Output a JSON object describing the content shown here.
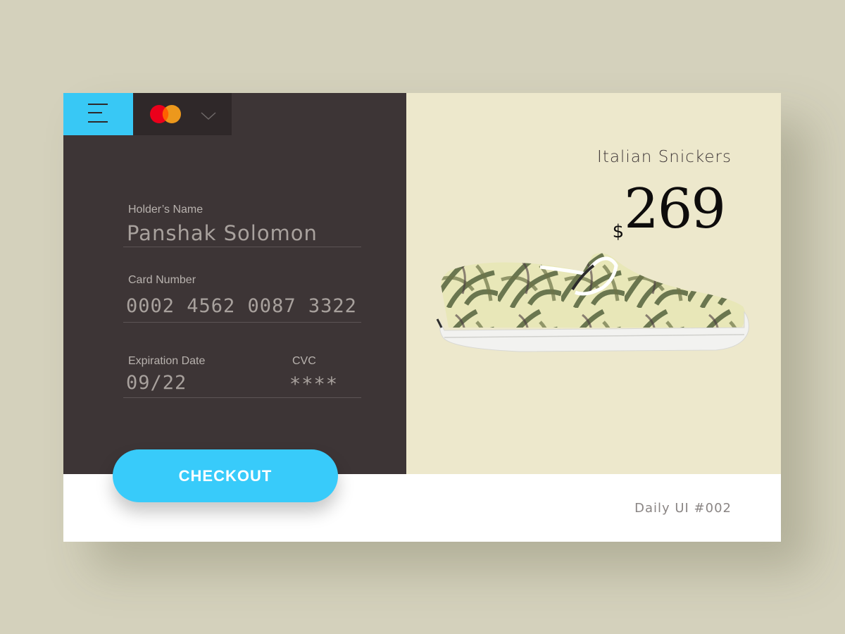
{
  "colors": {
    "page_background": "#d4d1bc",
    "left_panel": "#3d3536",
    "right_panel": "#ede8cc",
    "accent": "#38c8f5",
    "mastercard_red": "#eb001b",
    "mastercard_orange": "#f79e1b"
  },
  "toolbar": {
    "menu_icon": "hamburger-menu-icon",
    "card_logo": "mastercard-logo",
    "dropdown_icon": "chevron-down-icon"
  },
  "form": {
    "holder_name_label": "Holder’s Name",
    "holder_name_value": "Panshak Solomon",
    "card_number_label": "Card Number",
    "card_number_value": "0002 4562 0087 3322",
    "expiration_label": "Expiration Date",
    "expiration_value": "09/22",
    "cvc_label": "CVC",
    "cvc_value": "****"
  },
  "checkout_label": "CHECKOUT",
  "product": {
    "name": "Italian Snickers",
    "currency": "$",
    "price": "269"
  },
  "footer": {
    "tag": "Daily UI #002"
  }
}
